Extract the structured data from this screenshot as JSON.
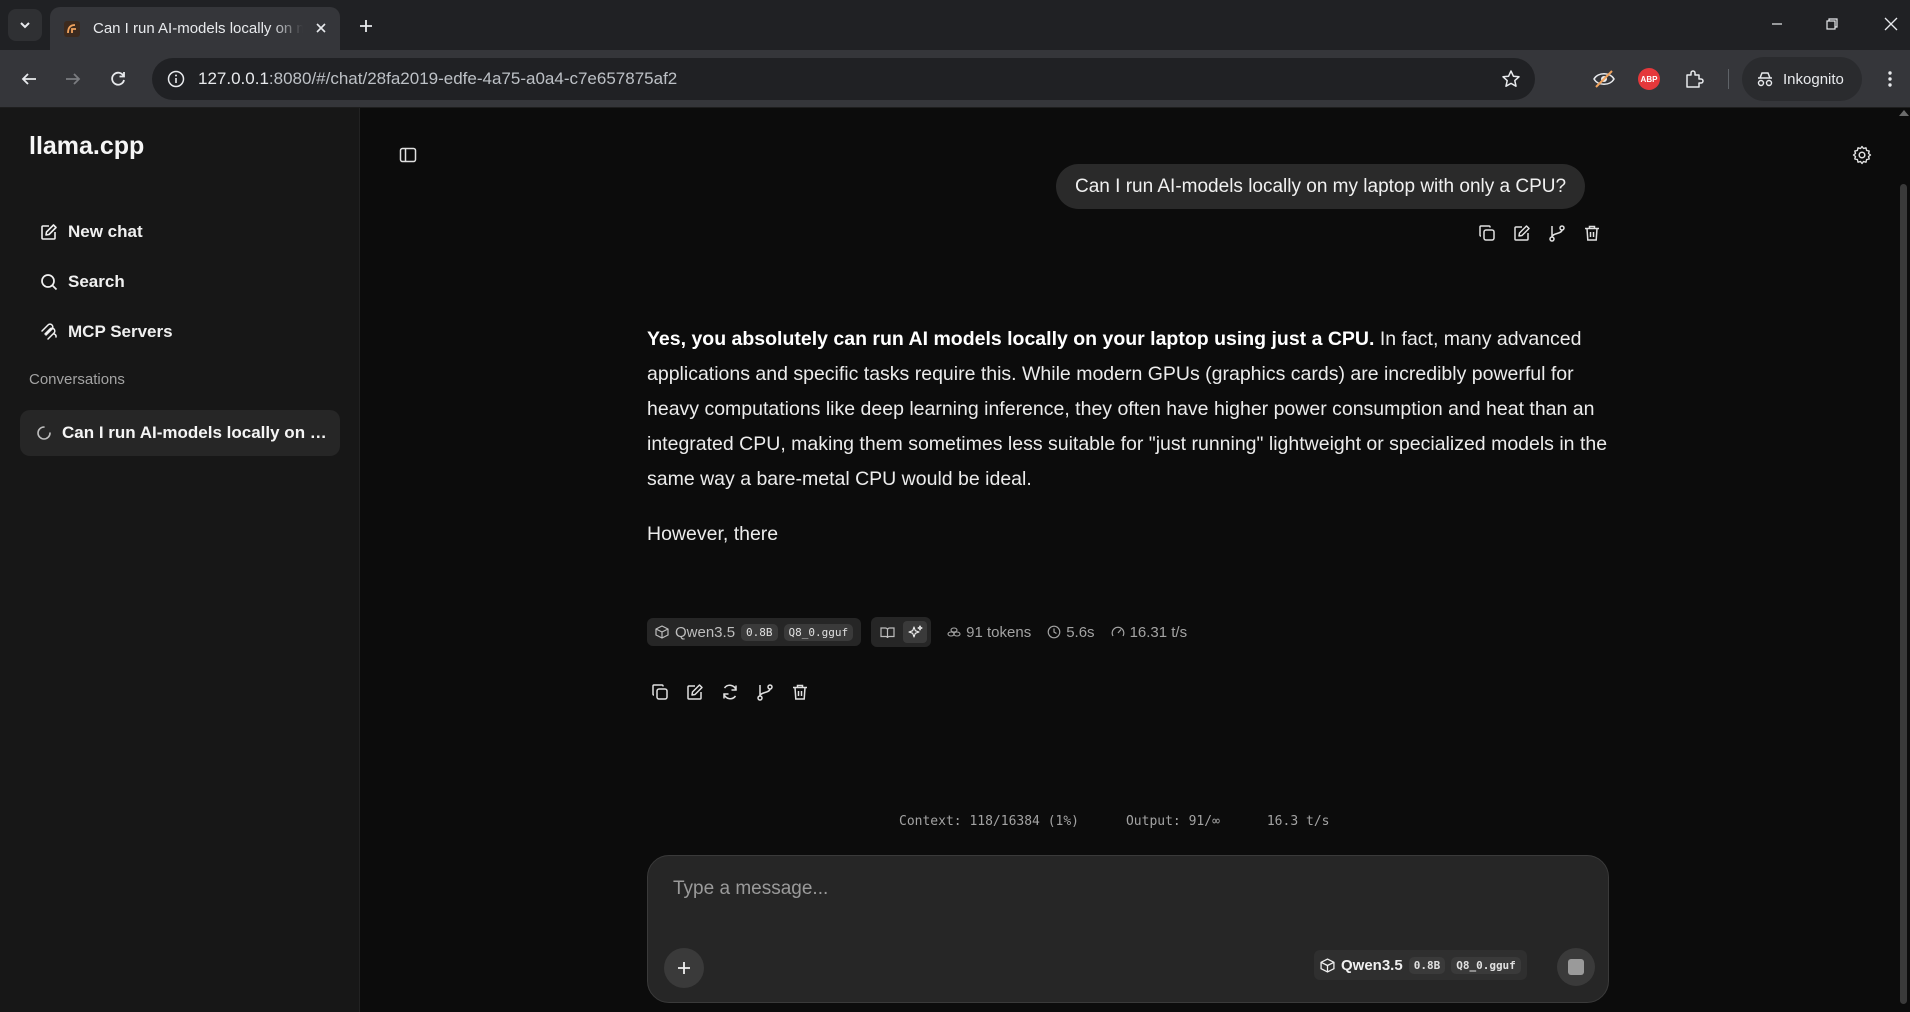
{
  "browser": {
    "tab_title": "Can I run AI-models locally on my laptop with only a CPU?",
    "url_host": "127.0.0.1",
    "url_rest": ":8080/#/chat/28fa2019-edfe-4a75-a0a4-c7e657875af2",
    "profile_label": "Inkognito",
    "abp_label": "ABP"
  },
  "sidebar": {
    "brand": "llama.cpp",
    "items": [
      {
        "label": "New chat",
        "icon": "edit-icon"
      },
      {
        "label": "Search",
        "icon": "search-icon"
      },
      {
        "label": "MCP Servers",
        "icon": "mcp-icon"
      }
    ],
    "section_title": "Conversations",
    "conversations": [
      {
        "title": "Can I run AI-models locally on my laptop with only a CPU?",
        "status": "loading"
      }
    ]
  },
  "chat": {
    "user_message": "Can I run AI-models locally on my laptop with only a CPU?",
    "assistant": {
      "bold_intro": "Yes, you absolutely can run AI models locally on your laptop using just a CPU.",
      "para1_rest": " In fact, many advanced applications and specific tasks require this. While modern GPUs (graphics cards) are incredibly powerful for heavy computations like deep learning inference, they often have higher power consumption and heat than an integrated CPU, making them sometimes less suitable for \"just running\" lightweight or specialized models in the same way a bare-metal CPU would be ideal.",
      "para2": "However, there"
    },
    "meta": {
      "model_name": "Qwen3.5",
      "model_size": "0.8B",
      "model_quant": "Q8_0.gguf",
      "tokens": "91 tokens",
      "time": "5.6s",
      "speed": "16.31 t/s"
    },
    "context_line": "Context: 118/16384 (1%)      Output: 91/∞      16.3 t/s"
  },
  "composer": {
    "placeholder": "Type a message...",
    "model_name": "Qwen3.5",
    "model_size": "0.8B",
    "model_quant": "Q8_0.gguf"
  },
  "colors": {
    "background": "#0c0c0c",
    "sidebar": "#171717",
    "bubble": "#2a2a2a",
    "chrome": "#35363a"
  }
}
